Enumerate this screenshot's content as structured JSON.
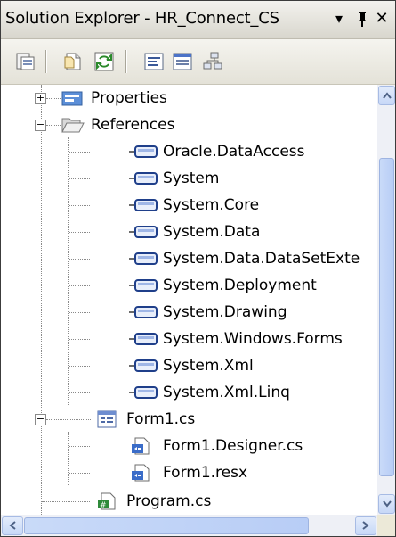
{
  "window": {
    "title": "Solution Explorer - HR_Connect_CS",
    "dropdown_glyph": "▾",
    "pin_glyph": "ꟸ",
    "close_glyph": "✕"
  },
  "toolbar": {
    "icons": [
      "properties-icon",
      "show-all-files-icon",
      "refresh-icon",
      "view-code-icon",
      "view-designer-icon",
      "class-diagram-icon"
    ]
  },
  "tree": {
    "items": [
      {
        "label": "Properties",
        "icon": "properties-folder-icon",
        "expander": "+"
      },
      {
        "label": "References",
        "icon": "folder-open-icon",
        "expander": "−"
      },
      {
        "label": "Oracle.DataAccess",
        "icon": "reference-icon"
      },
      {
        "label": "System",
        "icon": "reference-icon"
      },
      {
        "label": "System.Core",
        "icon": "reference-icon"
      },
      {
        "label": "System.Data",
        "icon": "reference-icon"
      },
      {
        "label": "System.Data.DataSetExte",
        "icon": "reference-icon"
      },
      {
        "label": "System.Deployment",
        "icon": "reference-icon"
      },
      {
        "label": "System.Drawing",
        "icon": "reference-icon"
      },
      {
        "label": "System.Windows.Forms",
        "icon": "reference-icon"
      },
      {
        "label": "System.Xml",
        "icon": "reference-icon"
      },
      {
        "label": "System.Xml.Linq",
        "icon": "reference-icon"
      },
      {
        "label": "Form1.cs",
        "icon": "form-icon",
        "expander": "−"
      },
      {
        "label": "Form1.Designer.cs",
        "icon": "cs-file-icon"
      },
      {
        "label": "Form1.resx",
        "icon": "resx-file-icon"
      },
      {
        "label": "Program.cs",
        "icon": "cs-program-icon"
      }
    ]
  },
  "scrollbars": {
    "vertical_position": 0.15,
    "horizontal_position": 0.0
  }
}
